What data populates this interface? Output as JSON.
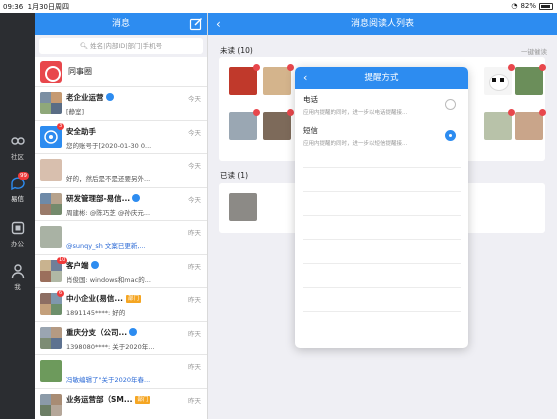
{
  "status": {
    "time": "09:36",
    "date": "1月30日周四",
    "battery": "82%"
  },
  "rail": [
    {
      "label": "社区",
      "icon": "community-icon"
    },
    {
      "label": "易信",
      "icon": "chat-icon",
      "badge": "99",
      "active": true
    },
    {
      "label": "办公",
      "icon": "office-icon"
    },
    {
      "label": "我",
      "icon": "me-icon"
    }
  ],
  "messages": {
    "title": "消息",
    "search_placeholder": "姓名|内部ID|部门|手机号",
    "pinned": "同事圈",
    "rows": [
      {
        "title": "老企业运营",
        "time": "今天",
        "sub": "[静室]",
        "verified": true
      },
      {
        "title": "安全助手",
        "time": "今天",
        "sub": "您的账号于[2020-01-30 0...",
        "badge": "3"
      },
      {
        "title": "",
        "time": "今天",
        "sub": "好的，然后是不是还要另外..."
      },
      {
        "title": "研发管理部-易信...",
        "time": "今天",
        "sub": "周建彬: @陈巧芝 @孙庆元...",
        "verified": true
      },
      {
        "title": "",
        "time": "昨天",
        "sub": "@sunqy_sh 文案已更新,...",
        "sub_blue": true
      },
      {
        "title": "客户端",
        "time": "昨天",
        "sub": "肖俊国: windows和mac的...",
        "verified": true,
        "badge": "10"
      },
      {
        "title": "中小企业(易信...",
        "time": "昨天",
        "sub": "1891145****: 好的",
        "tag": "部门",
        "badge": "6"
      },
      {
        "title": "重庆分支（公司...",
        "time": "昨天",
        "sub": "1398080****: 关于2020年...",
        "verified": true
      },
      {
        "title": "",
        "time": "昨天",
        "sub": "冯敏编辑了\"关于2020年春...",
        "sub_blue": true
      },
      {
        "title": "业务运营部（SM...",
        "time": "昨天",
        "sub": "",
        "tag": "部门"
      }
    ]
  },
  "reader": {
    "title": "消息阅读人列表",
    "unread_label": "未读 (10)",
    "urge_label": "一键催读",
    "read_label": "已读 (1)"
  },
  "reminder": {
    "title": "提醒方式",
    "options": [
      {
        "name": "电话",
        "desc": "应用内提醒的同时，进一步以电话提醒接...",
        "selected": false
      },
      {
        "name": "短信",
        "desc": "应用内提醒的同时，进一步以短信提醒接...",
        "selected": true
      }
    ]
  },
  "colors": {
    "accent": "#2d8cf0",
    "rail": "#2b2d31",
    "tag": "#f5a623",
    "red": "#f03a3a"
  }
}
